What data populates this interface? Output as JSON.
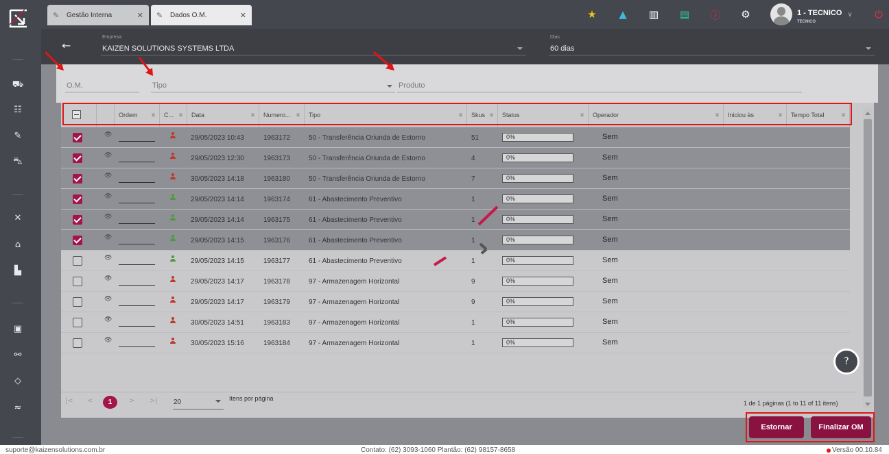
{
  "tabs": [
    {
      "label": "Gestão Interna",
      "icon": "document-icon"
    },
    {
      "label": "Dados O.M.",
      "icon": "document-icon"
    }
  ],
  "user": {
    "name": "1 - TECNICO",
    "role": "TECNICO"
  },
  "header": {
    "empresa_label": "Empresa",
    "empresa_value": "KAIZEN SOLUTIONS SYSTEMS LTDA",
    "dias_label": "Dias",
    "dias_value": "60 dias"
  },
  "filters": {
    "om": "O.M.",
    "tipo": "Tipo",
    "produto": "Produto"
  },
  "columns": [
    "Ordem",
    "C...",
    "Data",
    "Numero...",
    "Tipo",
    "Skus",
    "Status",
    "Operador",
    "Iniciou às",
    "Tempo Total"
  ],
  "rows": [
    {
      "selected": true,
      "person_color": "#c0392b",
      "data": "29/05/2023 10:43",
      "numero": "1963172",
      "tipo": "50 - Transferência Oriunda de Estorno",
      "skus": "51",
      "status": "0%",
      "operador": "Sem"
    },
    {
      "selected": true,
      "person_color": "#c0392b",
      "data": "29/05/2023 12:30",
      "numero": "1963173",
      "tipo": "50 - Transferência Oriunda de Estorno",
      "skus": "4",
      "status": "0%",
      "operador": "Sem"
    },
    {
      "selected": true,
      "person_color": "#c0392b",
      "data": "30/05/2023 14:18",
      "numero": "1963180",
      "tipo": "50 - Transferência Oriunda de Estorno",
      "skus": "7",
      "status": "0%",
      "operador": "Sem"
    },
    {
      "selected": true,
      "person_color": "#4c9a3a",
      "data": "29/05/2023 14:14",
      "numero": "1963174",
      "tipo": "61 - Abastecimento Preventivo",
      "skus": "1",
      "status": "0%",
      "operador": "Sem"
    },
    {
      "selected": true,
      "person_color": "#4c9a3a",
      "data": "29/05/2023 14:14",
      "numero": "1963175",
      "tipo": "61 - Abastecimento Preventivo",
      "skus": "1",
      "status": "0%",
      "operador": "Sem"
    },
    {
      "selected": true,
      "person_color": "#4c9a3a",
      "data": "29/05/2023 14:15",
      "numero": "1963176",
      "tipo": "61 - Abastecimento Preventivo",
      "skus": "1",
      "status": "0%",
      "operador": "Sem"
    },
    {
      "selected": false,
      "person_color": "#4c9a3a",
      "data": "29/05/2023 14:15",
      "numero": "1963177",
      "tipo": "61 - Abastecimento Preventivo",
      "skus": "1",
      "status": "0%",
      "operador": "Sem"
    },
    {
      "selected": false,
      "person_color": "#c0392b",
      "data": "29/05/2023 14:17",
      "numero": "1963178",
      "tipo": "97 - Armazenagem Horizontal",
      "skus": "9",
      "status": "0%",
      "operador": "Sem"
    },
    {
      "selected": false,
      "person_color": "#c0392b",
      "data": "29/05/2023 14:17",
      "numero": "1963179",
      "tipo": "97 - Armazenagem Horizontal",
      "skus": "9",
      "status": "0%",
      "operador": "Sem"
    },
    {
      "selected": false,
      "person_color": "#c0392b",
      "data": "30/05/2023 14:51",
      "numero": "1963183",
      "tipo": "97 - Armazenagem Horizontal",
      "skus": "1",
      "status": "0%",
      "operador": "Sem"
    },
    {
      "selected": false,
      "person_color": "#c0392b",
      "data": "30/05/2023 15:16",
      "numero": "1963184",
      "tipo": "97 - Armazenagem Horizontal",
      "skus": "1",
      "status": "0%",
      "operador": "Sem"
    }
  ],
  "pager": {
    "page": "1",
    "page_size": "20",
    "page_size_label": "Itens por página",
    "info": "1 de 1 páginas (1 to 11 of 11 itens)"
  },
  "actions": {
    "estornar": "Estornar",
    "finalizar": "Finalizar OM"
  },
  "footer": {
    "email": "suporte@kaizensolutions.com.br",
    "contact": "Contato: (62) 3093-1060   Plantão: (62) 98157-8658",
    "version": "Versão 00.10.84"
  },
  "colors": {
    "accent": "#a3154a",
    "button": "#8a1240",
    "annotation": "#e01515"
  }
}
